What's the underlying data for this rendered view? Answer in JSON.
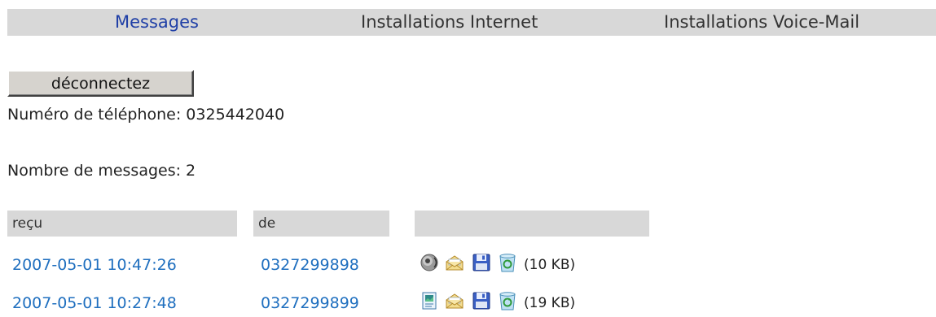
{
  "nav": {
    "items": [
      {
        "label": "Messages",
        "active": true
      },
      {
        "label": "Installations Internet",
        "active": false
      },
      {
        "label": "Installations Voice-Mail",
        "active": false
      }
    ],
    "background": "#d8d8d8",
    "active_color": "#1f3fa6"
  },
  "logout_button": {
    "label": "déconnectez"
  },
  "account": {
    "phone_text": "Numéro de téléphone: 0325442040",
    "count_text": "Nombre de messages: 2"
  },
  "messages_table": {
    "columns": [
      "reçu",
      "de",
      ""
    ],
    "rows": [
      {
        "received": "2007-05-01 10:47:26",
        "from": "0327299898",
        "icons": [
          "speaker-icon",
          "open-envelope-icon",
          "floppy-save-icon",
          "recycle-bin-icon"
        ],
        "size": "(10 KB)"
      },
      {
        "received": "2007-05-01 10:27:48",
        "from": "0327299899",
        "icons": [
          "document-icon",
          "open-envelope-icon",
          "floppy-save-icon",
          "recycle-bin-icon"
        ],
        "size": "(19 KB)"
      }
    ],
    "link_color": "#1f6fbf"
  }
}
